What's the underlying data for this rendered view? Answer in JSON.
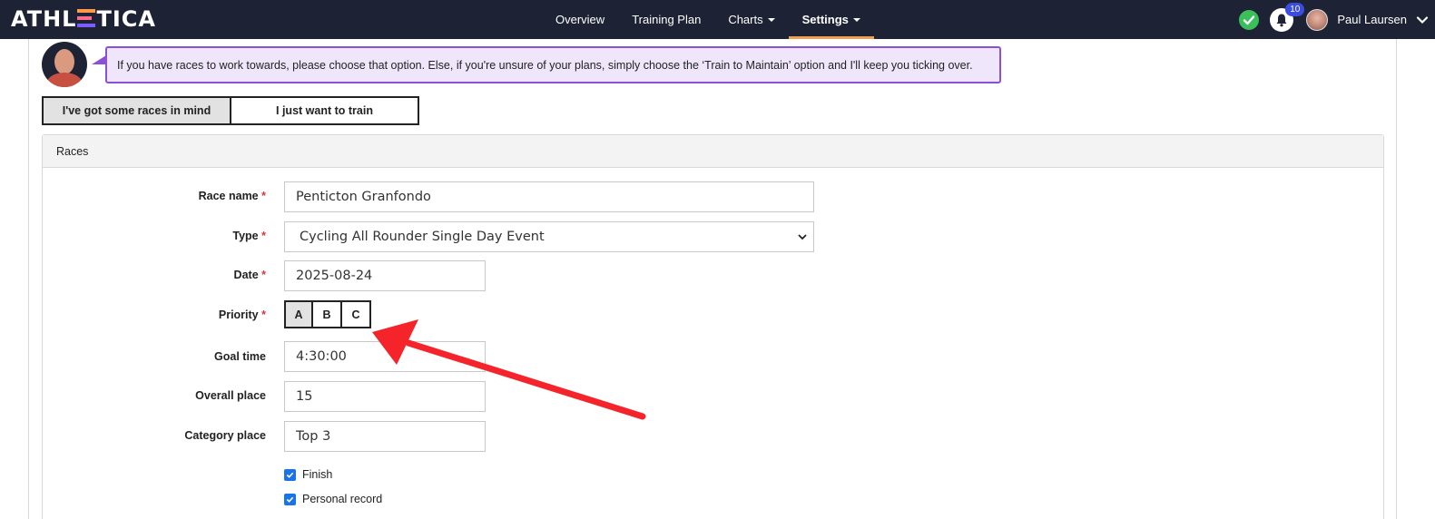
{
  "app": {
    "logo_text_left": "ATHL",
    "logo_text_right": "TICA"
  },
  "nav": {
    "items": [
      {
        "label": "Overview"
      },
      {
        "label": "Training Plan"
      },
      {
        "label": "Charts"
      },
      {
        "label": "Settings"
      }
    ]
  },
  "header_right": {
    "notification_count": "10",
    "username": "Paul Laursen"
  },
  "coach": {
    "message": "If you have races to work towards, please choose that option. Else, if you're unsure of your plans, simply choose the ‘Train to Maintain’ option and I'll keep you ticking over."
  },
  "mode": {
    "option_races": "I've got some races in mind",
    "option_train": "I just want to train",
    "selected": "I've got some races in mind"
  },
  "panel": {
    "title": "Races"
  },
  "form": {
    "race_name_label": "Race name",
    "race_name_value": "Penticton Granfondo",
    "type_label": "Type",
    "type_value": "Cycling All Rounder Single Day Event",
    "date_label": "Date",
    "date_value": "2025-08-24",
    "priority_label": "Priority",
    "priority_options": [
      "A",
      "B",
      "C"
    ],
    "priority_selected": "A",
    "goal_time_label": "Goal time",
    "goal_time_value": "4:30:00",
    "overall_place_label": "Overall place",
    "overall_place_value": "15",
    "category_place_label": "Category place",
    "category_place_value": "Top 3",
    "required_marker": "*",
    "finish_label": "Finish",
    "finish_checked": true,
    "pr_label": "Personal record",
    "pr_checked": true
  },
  "annotation": {
    "arrow_color": "#f5232a"
  },
  "colors": {
    "nav_bg": "#1e2235",
    "accent_purple": "#8a50d8",
    "active_underline": "#f0a050",
    "checkbox_blue": "#1a73e8"
  }
}
